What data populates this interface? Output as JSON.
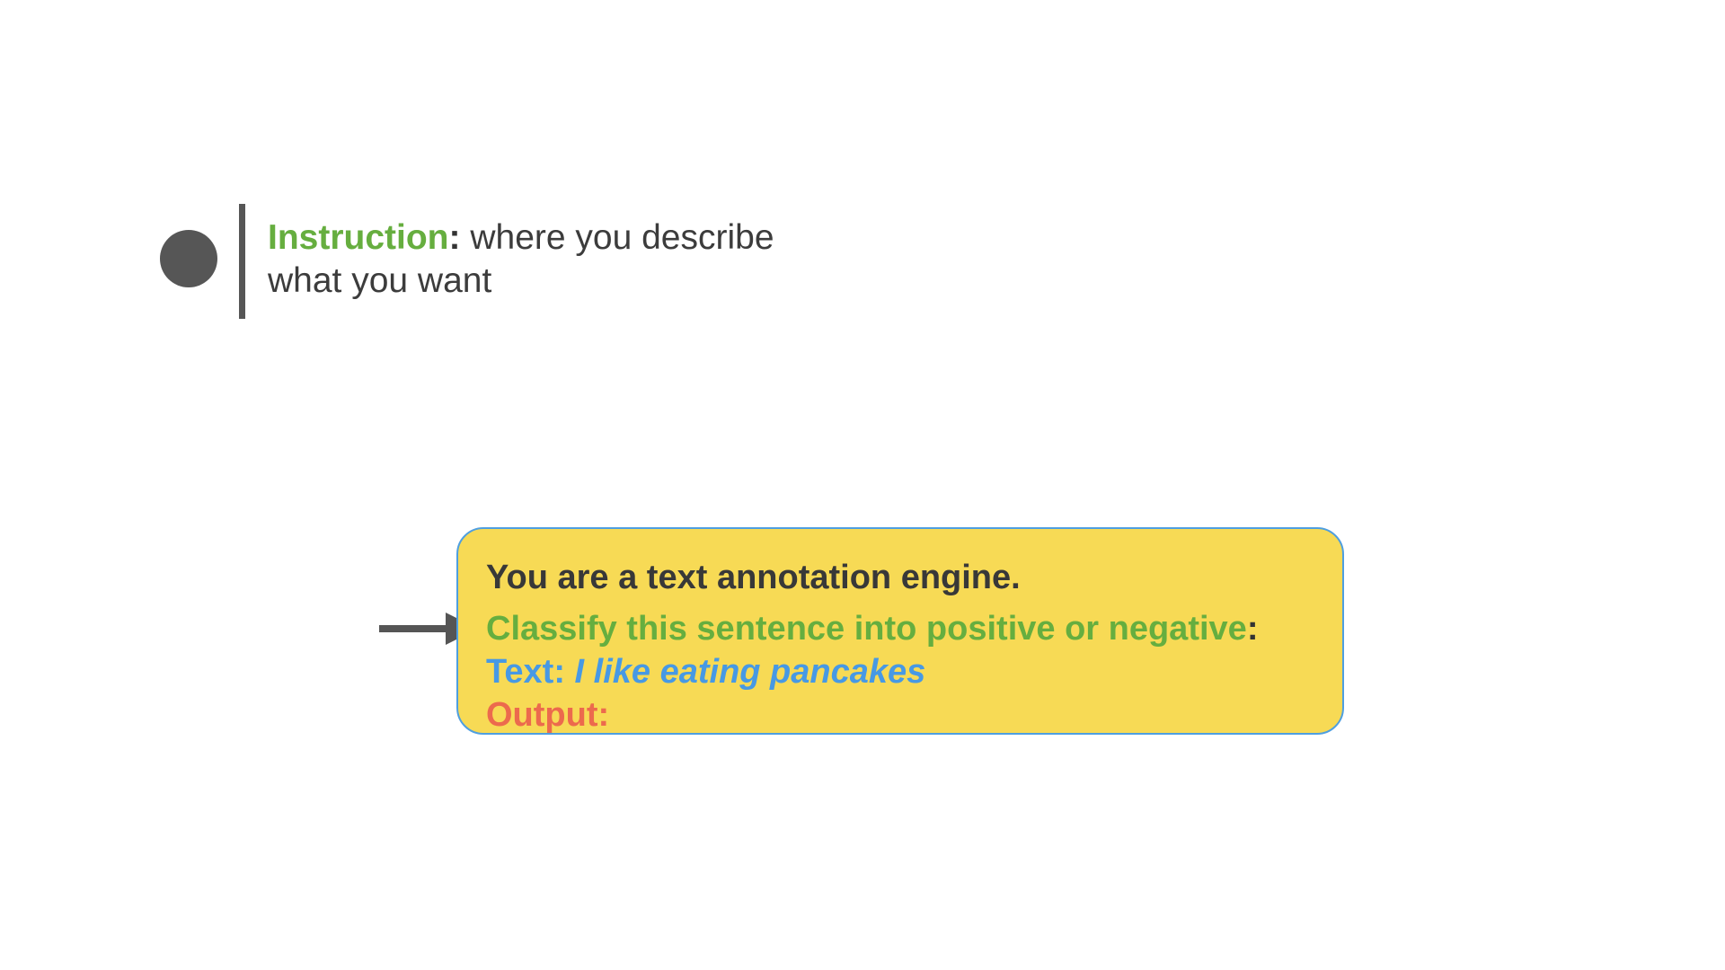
{
  "legend": {
    "term": "Instruction",
    "colon": ":",
    "description": " where you describe what you want"
  },
  "prompt": {
    "role_line": "You are a text annotation engine.",
    "instruction": "Classify this sentence into positive or negative",
    "instruction_colon": ":",
    "input_label": "Text:",
    "input_value": "I like eating pancakes",
    "output_label": "Output:"
  },
  "colors": {
    "instruction_green": "#66ae3f",
    "input_blue": "#4799e4",
    "output_red": "#ec6a4d",
    "box_yellow": "#f7da55",
    "box_border": "#4f9fe0",
    "bullet_gray": "#565656"
  },
  "icons": {
    "bullet": "filled-circle-bullet",
    "pointer": "right-arrow-icon"
  }
}
